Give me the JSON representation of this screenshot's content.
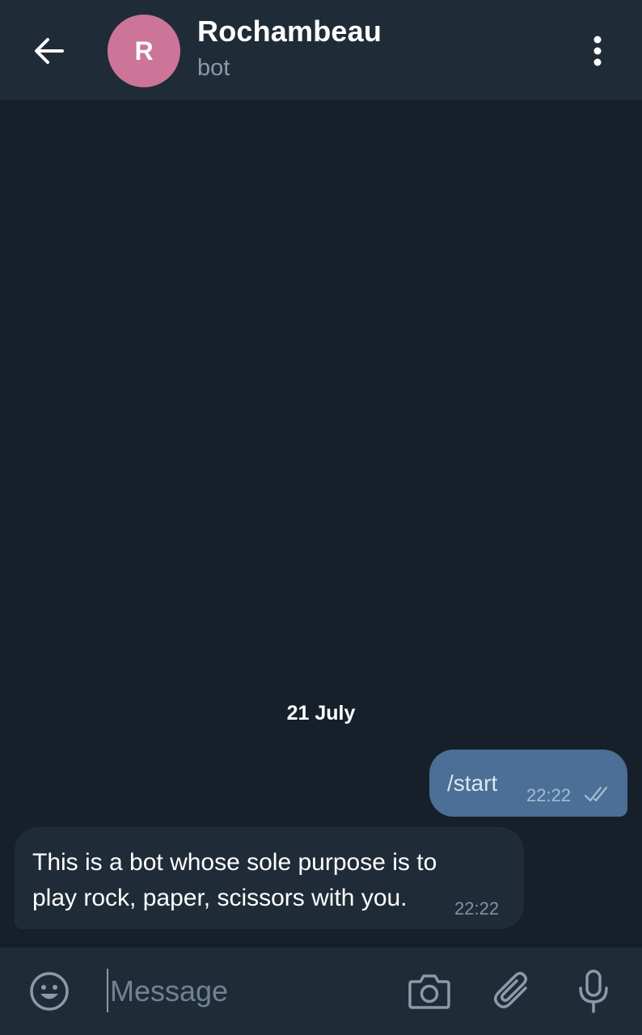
{
  "header": {
    "avatar_letter": "R",
    "title": "Rochambeau",
    "subtitle": "bot",
    "avatar_color": "#cc7598"
  },
  "chat": {
    "date_separator": "21 July",
    "messages": [
      {
        "direction": "outgoing",
        "text": "/start",
        "time": "22:22",
        "status": "read"
      },
      {
        "direction": "incoming",
        "text": "This is a bot whose sole purpose is to play rock, paper, scissors with you.",
        "time": "22:22"
      }
    ]
  },
  "composer": {
    "placeholder": "Message",
    "value": ""
  },
  "icons": {
    "back": "arrow-left-icon",
    "menu": "vertical-dots-icon",
    "emoji": "smiley-icon",
    "camera": "camera-icon",
    "attach": "paperclip-icon",
    "mic": "microphone-icon",
    "read_status": "double-check-icon"
  },
  "colors": {
    "background": "#17202a",
    "header": "#1f2c38",
    "outgoing_bubble": "#4b6f96",
    "incoming_bubble": "#1f2c38"
  }
}
